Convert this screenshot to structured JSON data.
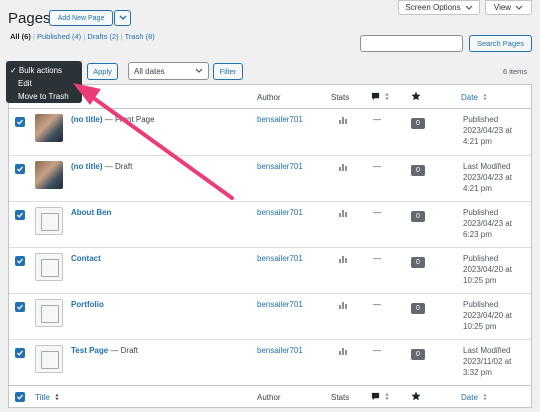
{
  "header": {
    "title": "Pages",
    "add_new_label": "Add New Page",
    "screen_options_label": "Screen Options",
    "view_label": "View"
  },
  "filters": {
    "all": "All (6)",
    "published": "Published (4)",
    "drafts": "Drafts (2)",
    "trash": "Trash (8)",
    "sep": "|"
  },
  "search": {
    "button_label": "Search Pages",
    "value": ""
  },
  "toolbar": {
    "apply_label": "Apply",
    "dates_label": "All dates",
    "filter_label": "Filter",
    "items_count": "6 items"
  },
  "bulk_menu": {
    "items": [
      "✓ Bulk actions",
      "Edit",
      "Move to Trash"
    ]
  },
  "table": {
    "header": {
      "title": "Title",
      "author": "Author",
      "stats": "Stats",
      "date": "Date"
    },
    "footer": {
      "title": "Title",
      "author": "Author",
      "stats": "Stats",
      "date": "Date"
    },
    "rows": [
      {
        "title": "(no title)",
        "suffix": " — Front Page",
        "author": "bensailer701",
        "stats": "—",
        "likes": "0",
        "date": "Published\n2023/04/23 at\n4:21 pm",
        "thumb": "photo"
      },
      {
        "title": "(no title)",
        "suffix": " — Draft",
        "author": "bensailer701",
        "stats": "—",
        "likes": "0",
        "date": "Last Modified\n2023/04/23 at\n4:21 pm",
        "thumb": "photo"
      },
      {
        "title": "About Ben",
        "suffix": "",
        "author": "bensailer701",
        "stats": "—",
        "likes": "0",
        "date": "Published\n2023/04/23 at\n6:23 pm",
        "thumb": "placeholder"
      },
      {
        "title": "Contact",
        "suffix": "",
        "author": "bensailer701",
        "stats": "—",
        "likes": "0",
        "date": "Published\n2023/04/20 at\n10:25 pm",
        "thumb": "placeholder"
      },
      {
        "title": "Portfolio",
        "suffix": "",
        "author": "bensailer701",
        "stats": "—",
        "likes": "0",
        "date": "Published\n2023/04/20 at\n10:25 pm",
        "thumb": "placeholder"
      },
      {
        "title": "Test Page",
        "suffix": " — Draft",
        "author": "bensailer701",
        "stats": "—",
        "likes": "0",
        "date": "Last Modified\n2023/11/02 at\n3:32 pm",
        "thumb": "placeholder"
      }
    ]
  },
  "colors": {
    "accent": "#2271b1",
    "arrow": "#ec3c77"
  }
}
